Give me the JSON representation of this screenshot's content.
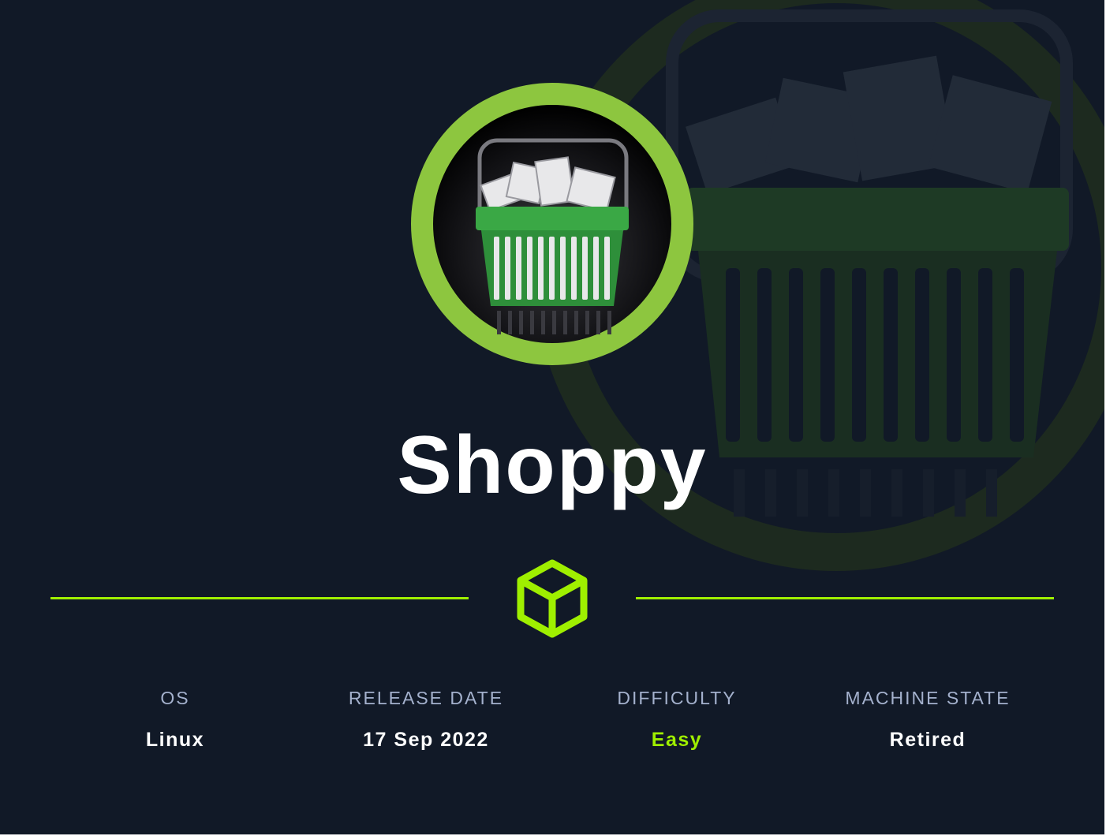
{
  "machine": {
    "name": "Shoppy",
    "avatar_icon": "shopping-basket-icon",
    "divider_icon": "hack-the-box-cube-icon"
  },
  "stats": [
    {
      "label": "OS",
      "value": "Linux"
    },
    {
      "label": "RELEASE DATE",
      "value": "17 Sep 2022"
    },
    {
      "label": "DIFFICULTY",
      "value": "Easy"
    },
    {
      "label": "MACHINE STATE",
      "value": "Retired"
    }
  ],
  "colors": {
    "background": "#111927",
    "accent": "#9fef00",
    "ring": "#8dc63f",
    "label": "#a4b1cd",
    "value": "#ffffff"
  }
}
